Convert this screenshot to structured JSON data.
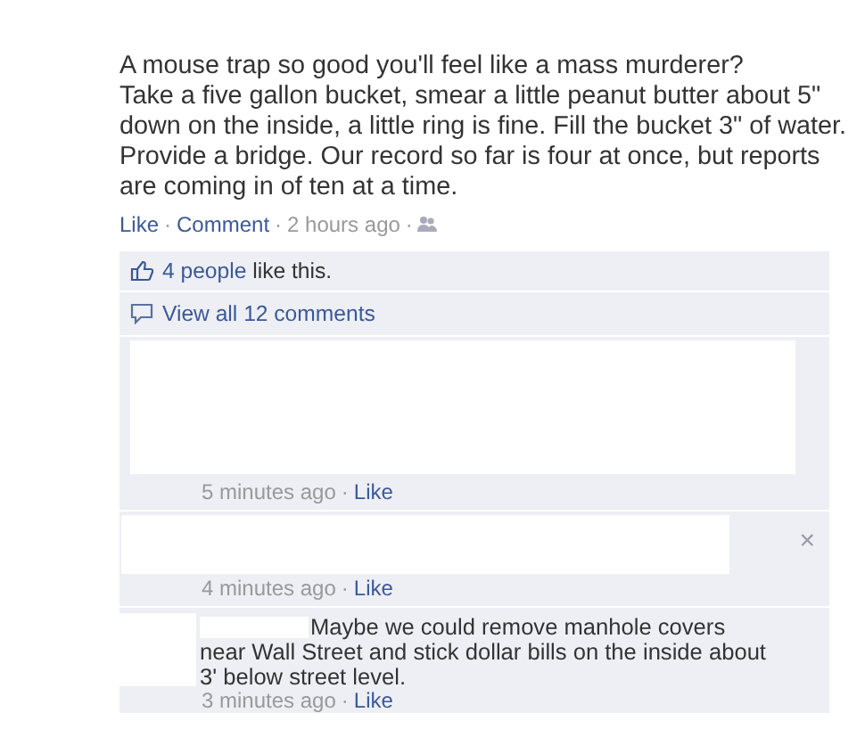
{
  "post": {
    "text": "A mouse trap so good you'll feel like a mass murderer?\nTake a five gallon bucket, smear a little peanut butter about 5\" down on the inside, a little ring is fine. Fill the bucket 3\" of water. Provide a bridge. Our record so far is four at once, but reports are coming in of ten at a time.",
    "actions": [
      {
        "label": "Like",
        "kind": "link"
      },
      {
        "label": "Comment",
        "kind": "link"
      },
      {
        "label": "2 hours ago",
        "kind": "time"
      }
    ],
    "separator": "·"
  },
  "likes": {
    "link": "4 people",
    "rest": "like this."
  },
  "view_all": "View all 12 comments",
  "comments": [
    {
      "time": "5 minutes ago",
      "separator": "·",
      "like": "Like",
      "kind": "block"
    },
    {
      "time": "4 minutes ago",
      "separator": "·",
      "like": "Like",
      "kind": "strip",
      "close": "×"
    },
    {
      "time": "3 minutes ago",
      "separator": "·",
      "like": "Like",
      "kind": "text",
      "text": "Maybe we could remove manhole covers near Wall Street and stick dollar bills on the inside about 3' below street level."
    }
  ]
}
